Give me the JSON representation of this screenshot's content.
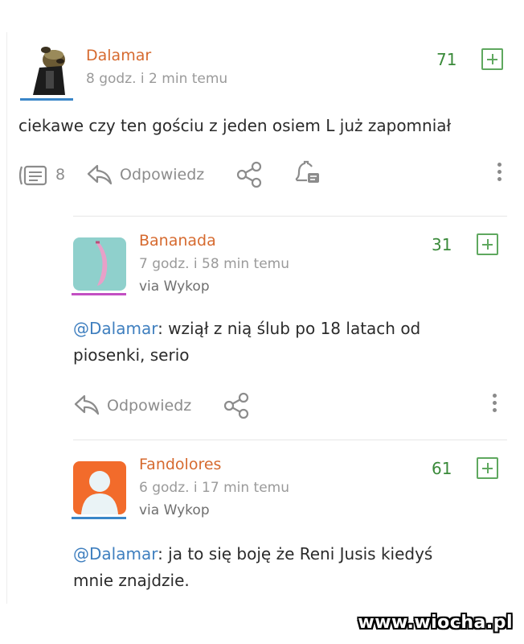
{
  "comments": [
    {
      "author": "Dalamar",
      "time": "8 godz. i 2 min temu",
      "via": "",
      "votes": "71",
      "text_plain": "ciekawe czy ten gościu z jeden osiem L już zapomniał",
      "replies_count": "8",
      "reply_label": "Odpowiedz",
      "avatar_underline_color": "#3a86c8"
    },
    {
      "author": "Bananada",
      "time": "7 godz. i 58 min temu",
      "via": "via Wykop",
      "votes": "31",
      "mention": "@Dalamar",
      "text_line1_rest": ": wziął z nią ślub po 18 latach od",
      "text_line2": "piosenki, serio",
      "reply_label": "Odpowiedz",
      "avatar_underline_color": "#c34fc3"
    },
    {
      "author": "Fandolores",
      "time": "6 godz. i 17 min temu",
      "via": "via Wykop",
      "votes": "61",
      "mention": "@Dalamar",
      "text_line1_rest": ": ja to się boję że Reni Jusis kiedyś",
      "text_line2": "mnie znajdzie.",
      "avatar_underline_color": "#3a86c8"
    }
  ],
  "colors": {
    "author": "#d66a2f",
    "votes": "#3a8a3a",
    "mention": "#3f7fbf"
  },
  "watermark": "www.wiocha.pl"
}
